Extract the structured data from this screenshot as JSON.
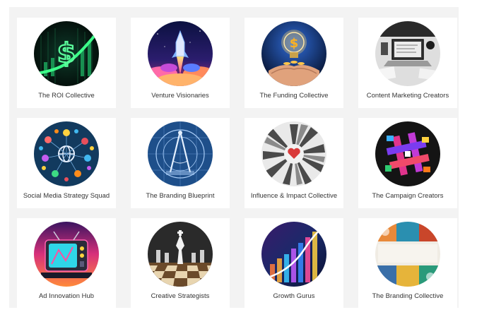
{
  "collectives": [
    {
      "label": "The ROI Collective",
      "icon": "dollar-growth-chart-icon"
    },
    {
      "label": "Venture Visionaries",
      "icon": "rocket-launch-icon"
    },
    {
      "label": "The Funding Collective",
      "icon": "lightbulb-dollar-icon"
    },
    {
      "label": "Content Marketing Creators",
      "icon": "laptop-desk-icon"
    },
    {
      "label": "Social Media Strategy Squad",
      "icon": "social-network-globe-icon"
    },
    {
      "label": "The Branding Blueprint",
      "icon": "blueprint-compass-icon"
    },
    {
      "label": "Influence & Impact Collective",
      "icon": "hands-heart-icon"
    },
    {
      "label": "The Campaign Creators",
      "icon": "hashtag-icon"
    },
    {
      "label": "Ad Innovation Hub",
      "icon": "retro-tv-icon"
    },
    {
      "label": "Creative Strategists",
      "icon": "chess-board-icon"
    },
    {
      "label": "Growth Gurus",
      "icon": "rising-bars-icon"
    },
    {
      "label": "The Branding Collective",
      "icon": "brand-collage-icon"
    }
  ]
}
